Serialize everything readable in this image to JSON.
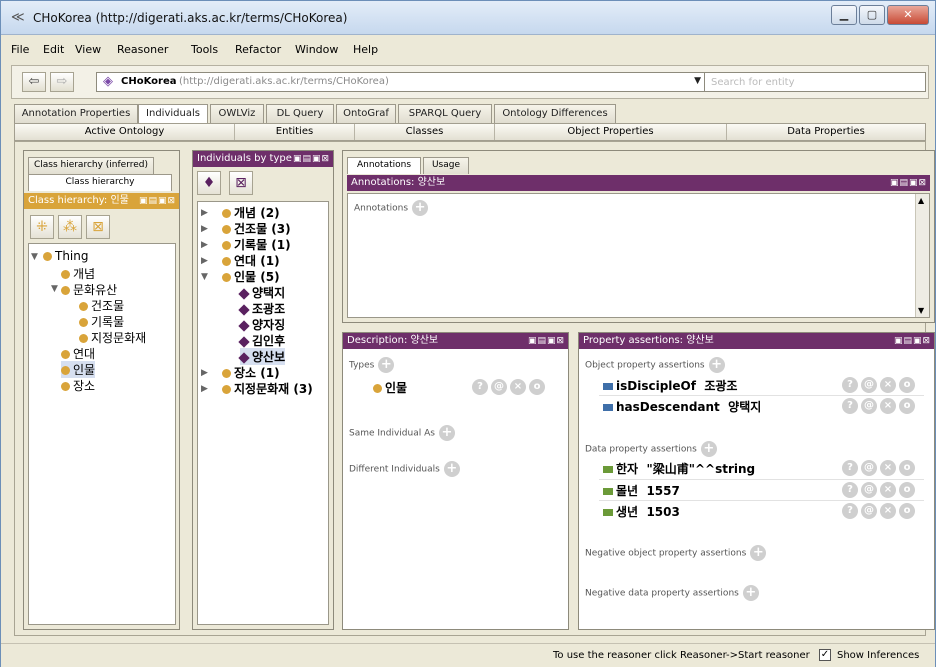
{
  "window": {
    "title": "CHoKorea (http://digerati.aks.ac.kr/terms/CHoKorea)"
  },
  "menu": [
    "File",
    "Edit",
    "View",
    "Reasoner",
    "Tools",
    "Refactor",
    "Window",
    "Help"
  ],
  "toolbar": {
    "ontology_name": "CHoKorea",
    "ontology_url": "(http://digerati.aks.ac.kr/terms/CHoKorea)",
    "search_placeholder": "Search for entity"
  },
  "tabs": [
    "Annotation Properties",
    "Individuals",
    "OWLViz",
    "DL Query",
    "OntoGraf",
    "SPARQL Query",
    "Ontology Differences"
  ],
  "active_tab": "Individuals",
  "subtabs": [
    "Active Ontology",
    "Entities",
    "Classes",
    "Object Properties",
    "Data Properties"
  ],
  "class_panel": {
    "tab_inferred": "Class hierarchy (inferred)",
    "tab_asserted": "Class hierarchy",
    "header": "Class hierarchy: 인물",
    "tree": [
      {
        "label": "Thing",
        "depth": 0,
        "expanded": true
      },
      {
        "label": "개념",
        "depth": 1
      },
      {
        "label": "문화유산",
        "depth": 1,
        "expanded": true
      },
      {
        "label": "건조물",
        "depth": 2
      },
      {
        "label": "기록물",
        "depth": 2
      },
      {
        "label": "지정문화재",
        "depth": 2
      },
      {
        "label": "연대",
        "depth": 1
      },
      {
        "label": "인물",
        "depth": 1,
        "selected": true
      },
      {
        "label": "장소",
        "depth": 1
      }
    ]
  },
  "individuals_panel": {
    "header": "Individuals by type",
    "groups": [
      {
        "label": "개념 (2)",
        "expanded": false
      },
      {
        "label": "건조물 (3)",
        "expanded": false
      },
      {
        "label": "기록물 (1)",
        "expanded": false
      },
      {
        "label": "연대 (1)",
        "expanded": false
      },
      {
        "label": "인물 (5)",
        "expanded": true,
        "members": [
          "양택지",
          "조광조",
          "양자징",
          "김인후",
          "양산보"
        ]
      },
      {
        "label": "장소 (1)",
        "expanded": false
      },
      {
        "label": "지정문화재 (3)",
        "expanded": false
      }
    ],
    "selected": "양산보"
  },
  "annotations_panel": {
    "tab_annotations": "Annotations",
    "tab_usage": "Usage",
    "header": "Annotations: 양산보",
    "section": "Annotations"
  },
  "description_panel": {
    "header": "Description: 양산보",
    "types_label": "Types",
    "types": [
      "인물"
    ],
    "same_label": "Same Individual As",
    "different_label": "Different Individuals"
  },
  "property_panel": {
    "header": "Property assertions: 양산보",
    "object_label": "Object property assertions",
    "object_assertions": [
      {
        "property": "isDiscipleOf",
        "value": "조광조"
      },
      {
        "property": "hasDescendant",
        "value": "양택지"
      }
    ],
    "data_label": "Data property assertions",
    "data_assertions": [
      {
        "property": "한자",
        "value": "\"梁山甫\"^^string"
      },
      {
        "property": "몰년",
        "value": "1557"
      },
      {
        "property": "생년",
        "value": "1503"
      }
    ],
    "neg_object_label": "Negative object property assertions",
    "neg_data_label": "Negative data property assertions"
  },
  "status": {
    "message": "To use the reasoner click Reasoner->Start reasoner",
    "show_inferences": "Show Inferences",
    "show_inferences_checked": true
  },
  "colors": {
    "header_purple": "#6e2f6a",
    "class_orange": "#d9a43a",
    "object_blue": "#3f6fa9",
    "data_green": "#6b9a38",
    "individual_purple": "#5a2160"
  }
}
